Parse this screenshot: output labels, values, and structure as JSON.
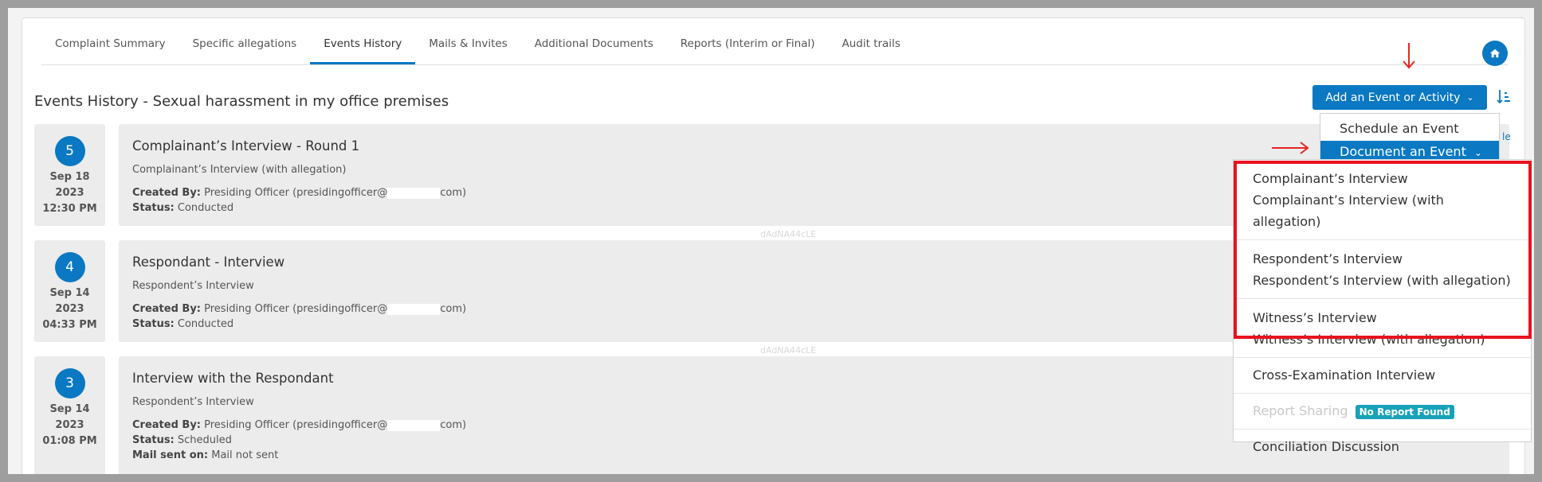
{
  "tabs": [
    {
      "label": "Complaint Summary",
      "active": false
    },
    {
      "label": "Specific allegations",
      "active": false
    },
    {
      "label": "Events History",
      "active": true
    },
    {
      "label": "Mails & Invites",
      "active": false
    },
    {
      "label": "Additional Documents",
      "active": false
    },
    {
      "label": "Reports (Interim or Final)",
      "active": false
    },
    {
      "label": "Audit trails",
      "active": false
    }
  ],
  "header": {
    "title": "Events History - Sexual harassment in my office premises",
    "add_button_label": "Add an Event or Activity",
    "home_icon": "home-icon",
    "sort_icon": "sort-icon"
  },
  "events": [
    {
      "number": "5",
      "month_day": "Sep 18",
      "year": "2023",
      "time": "12:30 PM",
      "title": "Complainant’s Interview - Round 1",
      "type": "Complainant’s Interview (with allegation)",
      "created_by_label": "Created By:",
      "created_by_value": "Presiding Officer (presidingofficer@",
      "created_by_suffix": "com)",
      "status_label": "Status:",
      "status_value": "Conducted"
    },
    {
      "number": "4",
      "month_day": "Sep 14",
      "year": "2023",
      "time": "04:33 PM",
      "title": "Respondant - Interview",
      "type": "Respondent’s Interview",
      "created_by_label": "Created By:",
      "created_by_value": "Presiding Officer (presidingofficer@",
      "created_by_suffix": "com)",
      "status_label": "Status:",
      "status_value": "Conducted"
    },
    {
      "number": "3",
      "month_day": "Sep 14",
      "year": "2023",
      "time": "01:08 PM",
      "title": "Interview with the Respondant",
      "type": "Respondent’s Interview",
      "created_by_label": "Created By:",
      "created_by_value": "Presiding Officer (presidingofficer@",
      "created_by_suffix": "com)",
      "status_label": "Status:",
      "status_value": "Scheduled",
      "mail_label": "Mail sent on:",
      "mail_value": "Mail not sent"
    }
  ],
  "watermark": "dAdNA44cLE",
  "partial_link": "le",
  "dropdown_primary": {
    "items": [
      "Schedule an Event"
    ],
    "active_item": "Document an Event"
  },
  "dropdown_submenu": {
    "groups": [
      {
        "line1": "Complainant’s Interview",
        "line2": "Complainant’s Interview (with allegation)"
      },
      {
        "line1": "Respondent’s Interview",
        "line2": "Respondent’s Interview (with allegation)"
      },
      {
        "line1": "Witness’s Interview",
        "line2": "Witness’s Interview (with allegation)"
      }
    ],
    "cross_exam": "Cross-Examination Interview",
    "report_sharing": "Report Sharing",
    "no_report_badge": "No Report Found",
    "conciliation": "Conciliation Discussion"
  },
  "colors": {
    "primary": "#0a78c2",
    "highlight": "#e8121f",
    "badge": "#17a2b8"
  }
}
